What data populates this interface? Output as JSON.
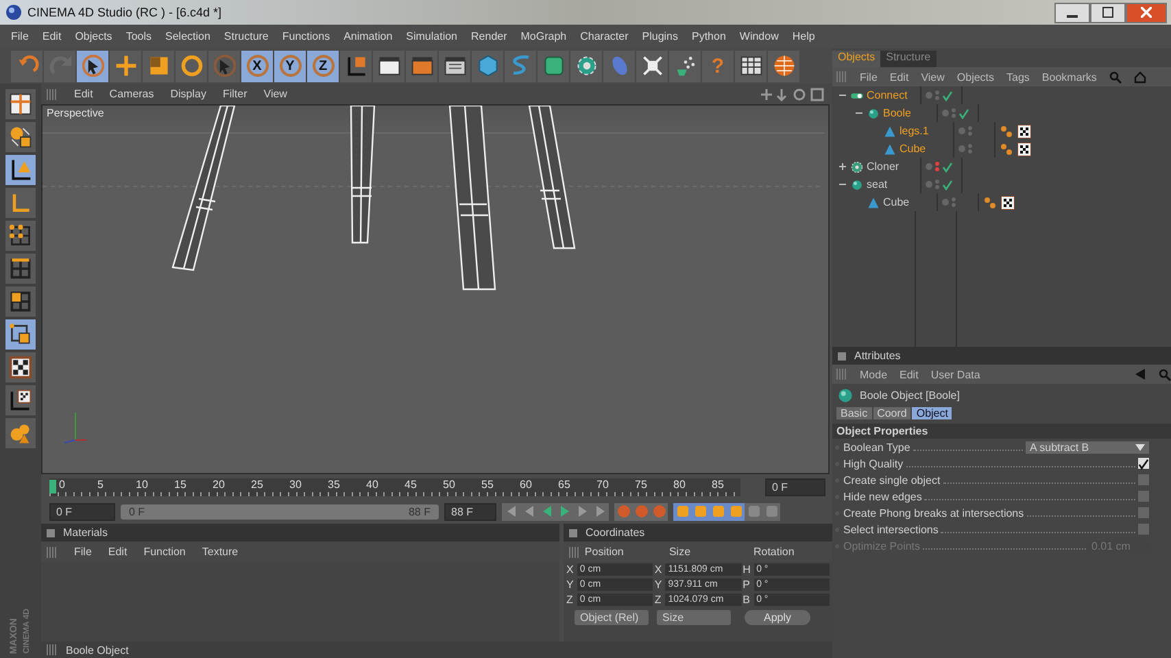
{
  "window": {
    "title": "CINEMA 4D Studio (RC ) - [6.c4d *]"
  },
  "menu": [
    "File",
    "Edit",
    "Objects",
    "Tools",
    "Selection",
    "Structure",
    "Functions",
    "Animation",
    "Simulation",
    "Render",
    "MoGraph",
    "Character",
    "Plugins",
    "Python",
    "Window",
    "Help"
  ],
  "toolbar": [
    {
      "kind": "undo",
      "selected": false
    },
    {
      "kind": "redo",
      "selected": false
    },
    {
      "kind": "select",
      "selected": true
    },
    {
      "kind": "move",
      "selected": false
    },
    {
      "kind": "scale",
      "selected": false
    },
    {
      "kind": "rotate",
      "selected": false
    },
    {
      "kind": "live",
      "selected": false
    },
    {
      "kind": "axis",
      "label": "X",
      "selected": true
    },
    {
      "kind": "axis",
      "label": "Y",
      "selected": true
    },
    {
      "kind": "axis",
      "label": "Z",
      "selected": true
    },
    {
      "kind": "coord",
      "selected": false
    },
    {
      "kind": "render-view",
      "selected": false
    },
    {
      "kind": "render",
      "selected": false
    },
    {
      "kind": "render-settings",
      "selected": false
    },
    {
      "kind": "cube",
      "selected": false
    },
    {
      "kind": "spline",
      "selected": false
    },
    {
      "kind": "nurbs",
      "selected": false
    },
    {
      "kind": "cloner",
      "selected": false
    },
    {
      "kind": "deformer",
      "selected": false
    },
    {
      "kind": "explode",
      "selected": false
    },
    {
      "kind": "particles",
      "selected": false
    },
    {
      "kind": "help",
      "label": "?",
      "selected": false
    },
    {
      "kind": "table",
      "selected": false
    },
    {
      "kind": "globe",
      "selected": false
    }
  ],
  "left_toolbar": [
    {
      "kind": "layout",
      "selected": false
    },
    {
      "kind": "model",
      "selected": false
    },
    {
      "kind": "object-axis",
      "selected": true
    },
    {
      "kind": "axis-l",
      "selected": false
    },
    {
      "kind": "points",
      "selected": false
    },
    {
      "kind": "edges",
      "selected": false
    },
    {
      "kind": "polygons",
      "selected": false
    },
    {
      "kind": "uv",
      "selected": true
    },
    {
      "kind": "checker",
      "selected": false
    },
    {
      "kind": "texture-axis",
      "selected": false
    },
    {
      "kind": "sculpt",
      "selected": false
    }
  ],
  "logo": [
    "MAXON",
    "CINEMA 4D"
  ],
  "viewport": {
    "menu": [
      "Edit",
      "Cameras",
      "Display",
      "Filter",
      "View"
    ],
    "camera": "Perspective"
  },
  "timeline": {
    "ticks": [
      "0",
      "5",
      "10",
      "15",
      "20",
      "25",
      "30",
      "35",
      "40",
      "45",
      "50",
      "55",
      "60",
      "65",
      "70",
      "75",
      "80",
      "85"
    ],
    "current_frame": "0 F",
    "start": "0 F",
    "range": {
      "start": "0 F",
      "end": "88 F",
      "level": 1
    },
    "end": "88 F"
  },
  "materials": {
    "title": "Materials",
    "menu": [
      "File",
      "Edit",
      "Function",
      "Texture"
    ]
  },
  "coordinates": {
    "title": "Coordinates",
    "columns": [
      "Position",
      "Size",
      "Rotation"
    ],
    "rows": [
      {
        "axis": "X",
        "position": "0 cm",
        "size_axis": "X",
        "size": "1151.809 cm",
        "rot_axis": "H",
        "rotation": "0 °"
      },
      {
        "axis": "Y",
        "position": "0 cm",
        "size_axis": "Y",
        "size": "937.911 cm",
        "rot_axis": "P",
        "rotation": "0 °"
      },
      {
        "axis": "Z",
        "position": "0 cm",
        "size_axis": "Z",
        "size": "1024.079 cm",
        "rot_axis": "B",
        "rotation": "0 °"
      }
    ],
    "mode": "Object (Rel)",
    "size_mode": "Size",
    "apply": "Apply"
  },
  "status_bar": "Boole Object",
  "objects": {
    "tabs": [
      {
        "label": "Objects",
        "selected": true
      },
      {
        "label": "Structure",
        "selected": false
      }
    ],
    "menu": [
      "File",
      "Edit",
      "View",
      "Objects",
      "Tags",
      "Bookmarks"
    ],
    "tree": [
      {
        "name": "Connect",
        "kind": "connect",
        "selected": true,
        "visible": true,
        "checked": true,
        "expanded": true,
        "children": [
          {
            "name": "Boole",
            "kind": "boole",
            "selected": true,
            "visible": true,
            "checked": true,
            "expanded": true,
            "children": [
              {
                "name": "legs.1",
                "kind": "polygon",
                "selected": true,
                "visible": true,
                "checked": false
              },
              {
                "name": "Cube",
                "kind": "polygon",
                "selected": true,
                "visible": true,
                "checked": false
              }
            ]
          }
        ]
      },
      {
        "name": "Cloner",
        "kind": "cloner",
        "selected": false,
        "visible": false,
        "checked": true,
        "expanded": false
      },
      {
        "name": "seat",
        "kind": "boole",
        "selected": false,
        "visible": true,
        "checked": true,
        "expanded": true,
        "children": [
          {
            "name": "Cube",
            "kind": "polygon",
            "selected": false,
            "visible": true,
            "checked": false
          }
        ]
      }
    ]
  },
  "attributes": {
    "title": "Attributes",
    "menu": [
      "Mode",
      "Edit",
      "User Data"
    ],
    "object": "Boole Object [Boole]",
    "tabs": [
      {
        "label": "Basic",
        "selected": false
      },
      {
        "label": "Coord",
        "selected": false
      },
      {
        "label": "Object",
        "selected": true
      }
    ],
    "section": "Object Properties",
    "rows": [
      {
        "label": "Boolean Type",
        "kind": "dropdown",
        "value": "A subtract B"
      },
      {
        "label": "High Quality",
        "kind": "checkbox",
        "checked": true
      },
      {
        "label": "Create single object",
        "kind": "checkbox",
        "checked": false
      },
      {
        "label": "Hide new edges",
        "kind": "checkbox",
        "checked": false
      },
      {
        "label": "Create Phong breaks at intersections",
        "kind": "checkbox",
        "checked": false
      },
      {
        "label": "Select intersections",
        "kind": "checkbox",
        "checked": false
      },
      {
        "label": "Optimize Points",
        "kind": "number",
        "value": "0.01 cm",
        "disabled": true
      }
    ]
  }
}
